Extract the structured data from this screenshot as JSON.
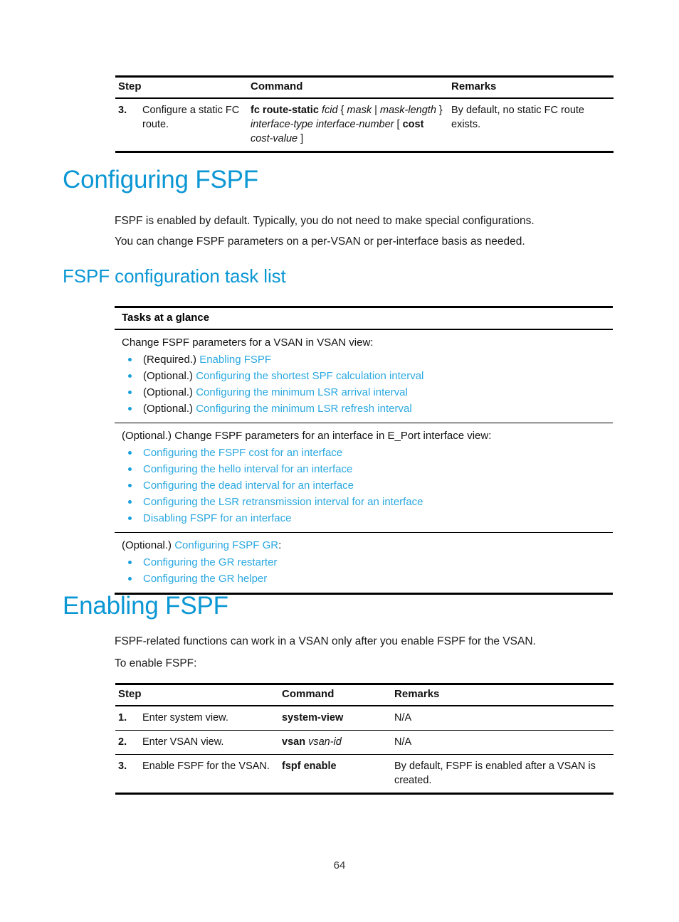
{
  "document": {
    "page_number": "64",
    "accent_heading_color": "#0b97d4",
    "link_color": "#2aa8e0",
    "step_number_color": "#16a0dc"
  },
  "top_table": {
    "headers": {
      "step": "Step",
      "command": "Command",
      "remarks": "Remarks"
    },
    "rows": [
      {
        "num": "3.",
        "step": "Configure a static FC route.",
        "command_parts": [
          {
            "text": "fc route-static",
            "style": "bold"
          },
          {
            "text": " ",
            "style": "plain"
          },
          {
            "text": "fcid",
            "style": "italic"
          },
          {
            "text": " { ",
            "style": "plain"
          },
          {
            "text": "mask",
            "style": "italic"
          },
          {
            "text": " | ",
            "style": "plain"
          },
          {
            "text": "mask-length",
            "style": "italic"
          },
          {
            "text": " } ",
            "style": "plain"
          },
          {
            "text": "interface-type interface-number",
            "style": "italic"
          },
          {
            "text": " [ ",
            "style": "plain"
          },
          {
            "text": "cost",
            "style": "bold"
          },
          {
            "text": " ",
            "style": "plain"
          },
          {
            "text": "cost-value",
            "style": "italic"
          },
          {
            "text": " ]",
            "style": "plain"
          }
        ],
        "remarks": "By default, no static FC route exists."
      }
    ]
  },
  "section_configuring_fspf": {
    "heading": "Configuring FSPF",
    "paragraphs": [
      "FSPF is enabled by default. Typically, you do not need to make special configurations.",
      "You can change FSPF parameters on a per-VSAN or per-interface basis as needed."
    ]
  },
  "section_task_list": {
    "heading": "FSPF configuration task list",
    "table_header": "Tasks at a glance",
    "groups": [
      {
        "intro_parts": [
          {
            "text": "Change FSPF parameters for a VSAN in VSAN view:",
            "style": "plain"
          }
        ],
        "items": [
          [
            {
              "text": "(Required.) ",
              "style": "plain"
            },
            {
              "text": "Enabling FSPF",
              "style": "link"
            }
          ],
          [
            {
              "text": "(Optional.) ",
              "style": "plain"
            },
            {
              "text": "Configuring the shortest SPF calculation interval",
              "style": "link"
            }
          ],
          [
            {
              "text": "(Optional.) ",
              "style": "plain"
            },
            {
              "text": "Configuring the minimum LSR arrival interval",
              "style": "link"
            }
          ],
          [
            {
              "text": "(Optional.) ",
              "style": "plain"
            },
            {
              "text": "Configuring the minimum LSR refresh interval",
              "style": "link"
            }
          ]
        ]
      },
      {
        "intro_parts": [
          {
            "text": "(Optional.) Change FSPF parameters for an interface in E_Port interface view:",
            "style": "plain"
          }
        ],
        "items": [
          [
            {
              "text": "Configuring the FSPF cost for an interface",
              "style": "link"
            }
          ],
          [
            {
              "text": "Configuring the hello interval for an interface",
              "style": "link"
            }
          ],
          [
            {
              "text": "Configuring the dead interval for an interface",
              "style": "link"
            }
          ],
          [
            {
              "text": "Configuring the LSR retransmission interval for an interface",
              "style": "link"
            }
          ],
          [
            {
              "text": "Disabling FSPF for an interface",
              "style": "link"
            }
          ]
        ]
      },
      {
        "intro_parts": [
          {
            "text": "(Optional.) ",
            "style": "plain"
          },
          {
            "text": "Configuring FSPF GR",
            "style": "link"
          },
          {
            "text": ":",
            "style": "plain"
          }
        ],
        "items": [
          [
            {
              "text": "Configuring the GR restarter",
              "style": "link"
            }
          ],
          [
            {
              "text": "Configuring the GR helper",
              "style": "link"
            }
          ]
        ]
      }
    ]
  },
  "section_enabling_fspf": {
    "heading": "Enabling FSPF",
    "paragraphs": [
      "FSPF-related functions can work in a VSAN only after you enable FSPF for the VSAN.",
      "To enable FSPF:"
    ],
    "table": {
      "headers": {
        "step": "Step",
        "command": "Command",
        "remarks": "Remarks"
      },
      "rows": [
        {
          "num": "1.",
          "step": "Enter system view.",
          "command_parts": [
            {
              "text": "system-view",
              "style": "bold"
            }
          ],
          "remarks": "N/A"
        },
        {
          "num": "2.",
          "step": "Enter VSAN view.",
          "command_parts": [
            {
              "text": "vsan",
              "style": "bold"
            },
            {
              "text": " ",
              "style": "plain"
            },
            {
              "text": "vsan-id",
              "style": "italic"
            }
          ],
          "remarks": "N/A"
        },
        {
          "num": "3.",
          "step": "Enable FSPF for the VSAN.",
          "command_parts": [
            {
              "text": "fspf enable",
              "style": "bold"
            }
          ],
          "remarks": "By default, FSPF is enabled after a VSAN is created."
        }
      ]
    }
  }
}
